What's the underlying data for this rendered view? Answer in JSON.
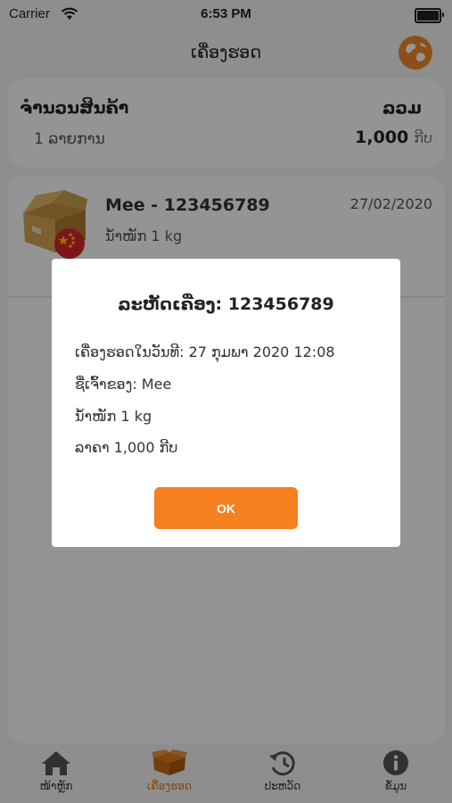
{
  "status_bar": {
    "carrier": "Carrier",
    "time": "6:53 PM"
  },
  "nav": {
    "title": "ເຄື່ອງຮອດ",
    "globe_icon": "globe-icon"
  },
  "summary": {
    "qty_label": "ຈຳນວນສິນຄ້າ",
    "total_label": "ລວມ",
    "qty_value": "1 ລາຍການ",
    "total_value": "1,000",
    "currency": "ກີບ"
  },
  "item": {
    "name": "Mee - 123456789",
    "date": "27/02/2020",
    "weight": "ນ້ຳໜັກ 1 kg",
    "icon": "package-china-icon"
  },
  "alert": {
    "title": "ລະຫັດເຄື່ອງ: 123456789",
    "arrived": "ເຄື່ອງຮອດໃນວັນທີ: 27 ກຸມພາ 2020 12:08",
    "owner": "ຊື່ເຈົ້າຂອງ: Mee",
    "weight": "ນ້ຳໜັກ 1 kg",
    "price": "ລາຄາ 1,000 ກີບ",
    "ok_label": "OK"
  },
  "tabs": [
    {
      "label": "ໜ້າຫຼັກ",
      "icon": "home-icon"
    },
    {
      "label": "ເຄື່ອງຮອດ",
      "icon": "box-icon",
      "active": true
    },
    {
      "label": "ປະຫວັດ",
      "icon": "history-icon"
    },
    {
      "label": "ຂໍ້ມູນ",
      "icon": "info-icon"
    }
  ],
  "colors": {
    "accent": "#f5801f",
    "overlay": "rgba(0,0,0,0.42)"
  }
}
